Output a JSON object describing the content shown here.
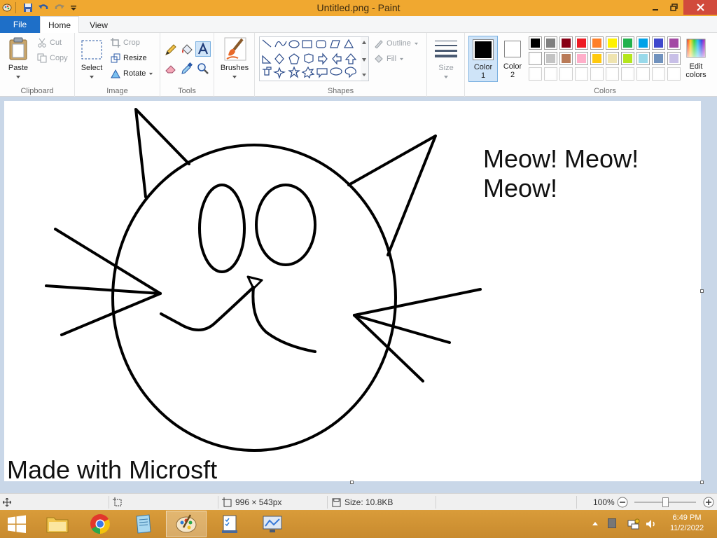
{
  "window": {
    "title": "Untitled.png - Paint"
  },
  "tabs": {
    "file": "File",
    "home": "Home",
    "view": "View"
  },
  "clipboard": {
    "paste": "Paste",
    "cut": "Cut",
    "copy": "Copy",
    "label": "Clipboard"
  },
  "image": {
    "select": "Select",
    "crop": "Crop",
    "resize": "Resize",
    "rotate": "Rotate",
    "label": "Image"
  },
  "tools": {
    "label": "Tools"
  },
  "brushes": {
    "label": "Brushes"
  },
  "shapes": {
    "outline": "Outline",
    "fill": "Fill",
    "label": "Shapes"
  },
  "size": {
    "label": "Size"
  },
  "color1": {
    "label1": "Color",
    "label2": "1",
    "value": "#000000"
  },
  "color2": {
    "label1": "Color",
    "label2": "2",
    "value": "#ffffff"
  },
  "colors": {
    "label": "Colors",
    "edit_line1": "Edit",
    "edit_line2": "colors",
    "row1": [
      "#000000",
      "#7f7f7f",
      "#880015",
      "#ed1c24",
      "#ff7f27",
      "#fff200",
      "#22b14c",
      "#00a2e8",
      "#3f48cc",
      "#a349a4"
    ],
    "row2": [
      "#ffffff",
      "#c3c3c3",
      "#b97a57",
      "#ffaec9",
      "#ffc90e",
      "#efe4b0",
      "#b5e61d",
      "#99d9ea",
      "#7092be",
      "#c8bfe7"
    ],
    "row3": [
      "#ffffff",
      "#ffffff",
      "#ffffff",
      "#ffffff",
      "#ffffff",
      "#ffffff",
      "#ffffff",
      "#ffffff",
      "#ffffff",
      "#ffffff"
    ]
  },
  "canvas": {
    "text_meow": "Meow! Meow!\nMeow!",
    "text_made_with": "Made with Microsft"
  },
  "status": {
    "dimensions": "996 × 543px",
    "size": "Size: 10.8KB",
    "zoom": "100%"
  },
  "clock": {
    "time": "6:49 PM",
    "date": "11/2/2022"
  }
}
